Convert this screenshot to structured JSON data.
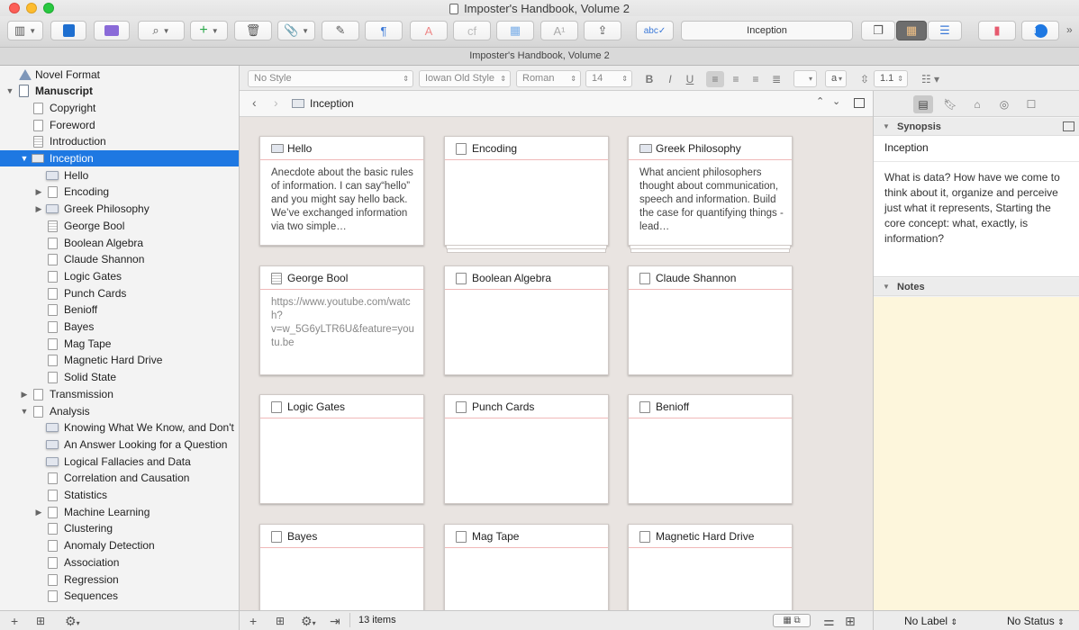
{
  "window": {
    "title": "Imposter's Handbook, Volume 2",
    "tab_title": "Imposter's Handbook, Volume 2"
  },
  "toolbar": {
    "center_label": "Inception"
  },
  "binder": {
    "items": [
      {
        "label": "Novel Format",
        "depth": 0,
        "icon": "novel",
        "disclosure": ""
      },
      {
        "label": "Manuscript",
        "depth": 0,
        "icon": "manu",
        "disclosure": "▼",
        "bold": true
      },
      {
        "label": "Copyright",
        "depth": 1,
        "icon": "doc",
        "disclosure": ""
      },
      {
        "label": "Foreword",
        "depth": 1,
        "icon": "doc",
        "disclosure": ""
      },
      {
        "label": "Introduction",
        "depth": 1,
        "icon": "lines",
        "disclosure": ""
      },
      {
        "label": "Inception",
        "depth": 1,
        "icon": "folder",
        "disclosure": "▼",
        "selected": true
      },
      {
        "label": "Hello",
        "depth": 2,
        "icon": "card",
        "disclosure": ""
      },
      {
        "label": "Encoding",
        "depth": 2,
        "icon": "doc",
        "disclosure": "▶"
      },
      {
        "label": "Greek Philosophy",
        "depth": 2,
        "icon": "card",
        "disclosure": "▶"
      },
      {
        "label": "George Bool",
        "depth": 2,
        "icon": "lines",
        "disclosure": ""
      },
      {
        "label": "Boolean Algebra",
        "depth": 2,
        "icon": "doc",
        "disclosure": ""
      },
      {
        "label": "Claude Shannon",
        "depth": 2,
        "icon": "doc",
        "disclosure": ""
      },
      {
        "label": "Logic Gates",
        "depth": 2,
        "icon": "doc",
        "disclosure": ""
      },
      {
        "label": "Punch Cards",
        "depth": 2,
        "icon": "doc",
        "disclosure": ""
      },
      {
        "label": "Benioff",
        "depth": 2,
        "icon": "doc",
        "disclosure": ""
      },
      {
        "label": "Bayes",
        "depth": 2,
        "icon": "doc",
        "disclosure": ""
      },
      {
        "label": "Mag Tape",
        "depth": 2,
        "icon": "doc",
        "disclosure": ""
      },
      {
        "label": "Magnetic Hard Drive",
        "depth": 2,
        "icon": "doc",
        "disclosure": ""
      },
      {
        "label": "Solid State",
        "depth": 2,
        "icon": "doc",
        "disclosure": ""
      },
      {
        "label": "Transmission",
        "depth": 1,
        "icon": "doc",
        "disclosure": "▶"
      },
      {
        "label": "Analysis",
        "depth": 1,
        "icon": "doc",
        "disclosure": "▼"
      },
      {
        "label": "Knowing What We Know, and Don't",
        "depth": 2,
        "icon": "card",
        "disclosure": ""
      },
      {
        "label": "An Answer Looking for a Question",
        "depth": 2,
        "icon": "card",
        "disclosure": ""
      },
      {
        "label": "Logical Fallacies and Data",
        "depth": 2,
        "icon": "card",
        "disclosure": ""
      },
      {
        "label": "Correlation and Causation",
        "depth": 2,
        "icon": "doc",
        "disclosure": ""
      },
      {
        "label": "Statistics",
        "depth": 2,
        "icon": "doc",
        "disclosure": ""
      },
      {
        "label": "Machine Learning",
        "depth": 2,
        "icon": "doc",
        "disclosure": "▶"
      },
      {
        "label": "Clustering",
        "depth": 2,
        "icon": "doc",
        "disclosure": ""
      },
      {
        "label": "Anomaly Detection",
        "depth": 2,
        "icon": "doc",
        "disclosure": ""
      },
      {
        "label": "Association",
        "depth": 2,
        "icon": "doc",
        "disclosure": ""
      },
      {
        "label": "Regression",
        "depth": 2,
        "icon": "doc",
        "disclosure": ""
      },
      {
        "label": "Sequences",
        "depth": 2,
        "icon": "doc",
        "disclosure": ""
      }
    ]
  },
  "format_bar": {
    "style": "No Style",
    "font": "Iowan Old Style",
    "typeface": "Roman",
    "size": "14",
    "line_spacing": "1.1"
  },
  "editor": {
    "header_title": "Inception",
    "item_count": "13 items"
  },
  "cards": [
    {
      "title": "Hello",
      "icon": "folder",
      "synopsis": "Anecdote about the basic rules of information. I can say“hello” and you might say hello back. We’ve exchanged information via two simple…",
      "stack": false,
      "url": false
    },
    {
      "title": "Encoding",
      "icon": "doc",
      "synopsis": "",
      "stack": true,
      "url": false
    },
    {
      "title": "Greek Philosophy",
      "icon": "folder",
      "synopsis": "What ancient philosophers thought about communication, speech and information. Build the case for quantifying things - lead…",
      "stack": true,
      "url": false
    },
    {
      "title": "George Bool",
      "icon": "lines",
      "synopsis": "https://www.youtube.com/watch?v=w_5G6yLTR6U&feature=youtu.be",
      "stack": false,
      "url": true
    },
    {
      "title": "Boolean Algebra",
      "icon": "doc",
      "synopsis": "",
      "stack": false,
      "url": false
    },
    {
      "title": "Claude Shannon",
      "icon": "doc",
      "synopsis": "",
      "stack": false,
      "url": false
    },
    {
      "title": "Logic Gates",
      "icon": "doc",
      "synopsis": "",
      "stack": false,
      "url": false
    },
    {
      "title": "Punch Cards",
      "icon": "doc",
      "synopsis": "",
      "stack": false,
      "url": false
    },
    {
      "title": "Benioff",
      "icon": "doc",
      "synopsis": "",
      "stack": false,
      "url": false
    },
    {
      "title": "Bayes",
      "icon": "doc",
      "synopsis": "",
      "stack": false,
      "url": false
    },
    {
      "title": "Mag Tape",
      "icon": "doc",
      "synopsis": "",
      "stack": false,
      "url": false
    },
    {
      "title": "Magnetic Hard Drive",
      "icon": "doc",
      "synopsis": "",
      "stack": false,
      "url": false
    }
  ],
  "inspector": {
    "synopsis_header": "Synopsis",
    "synopsis_title": "Inception",
    "synopsis_text": "What is data? How have we come to think about it, organize and perceive just what it represents, Starting the core concept: what, exactly, is information?",
    "notes_header": "Notes",
    "label_value": "No Label",
    "status_value": "No Status"
  },
  "colors": {
    "selection": "#1e78e2",
    "notes_bg": "#fdf6dc",
    "corkboard": "#e9e4e1",
    "card_rule": "#f0b8b8"
  }
}
